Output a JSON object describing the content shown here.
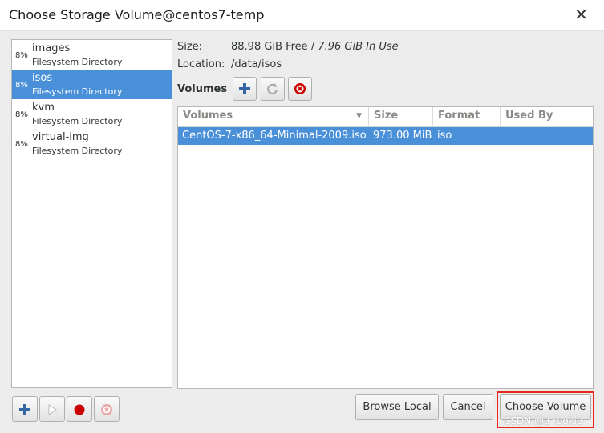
{
  "window": {
    "title": "Choose Storage Volume@centos7-temp"
  },
  "pools": [
    {
      "pct": "8%",
      "name": "images",
      "type": "Filesystem Directory"
    },
    {
      "pct": "8%",
      "name": "isos",
      "type": "Filesystem Directory"
    },
    {
      "pct": "8%",
      "name": "kvm",
      "type": "Filesystem Directory"
    },
    {
      "pct": "8%",
      "name": "virtual-img",
      "type": "Filesystem Directory"
    }
  ],
  "info": {
    "size_label": "Size:",
    "size_free": "88.98 GiB Free",
    "size_sep": " / ",
    "size_used": "7.96 GiB In Use",
    "location_label": "Location:",
    "location_value": "/data/isos"
  },
  "volumes": {
    "label": "Volumes",
    "columns": [
      "Volumes",
      "Size",
      "Format",
      "Used By"
    ],
    "rows": [
      {
        "name": "CentOS-7-x86_64-Minimal-2009.iso",
        "size": "973.00 MiB",
        "format": "iso",
        "used_by": ""
      }
    ]
  },
  "buttons": {
    "browse_local": "Browse Local",
    "cancel": "Cancel",
    "choose_volume": "Choose Volume"
  },
  "watermark": "CSDN @a rookie.",
  "colors": {
    "selection": "#4a90d9",
    "highlight": "#e8261c"
  }
}
